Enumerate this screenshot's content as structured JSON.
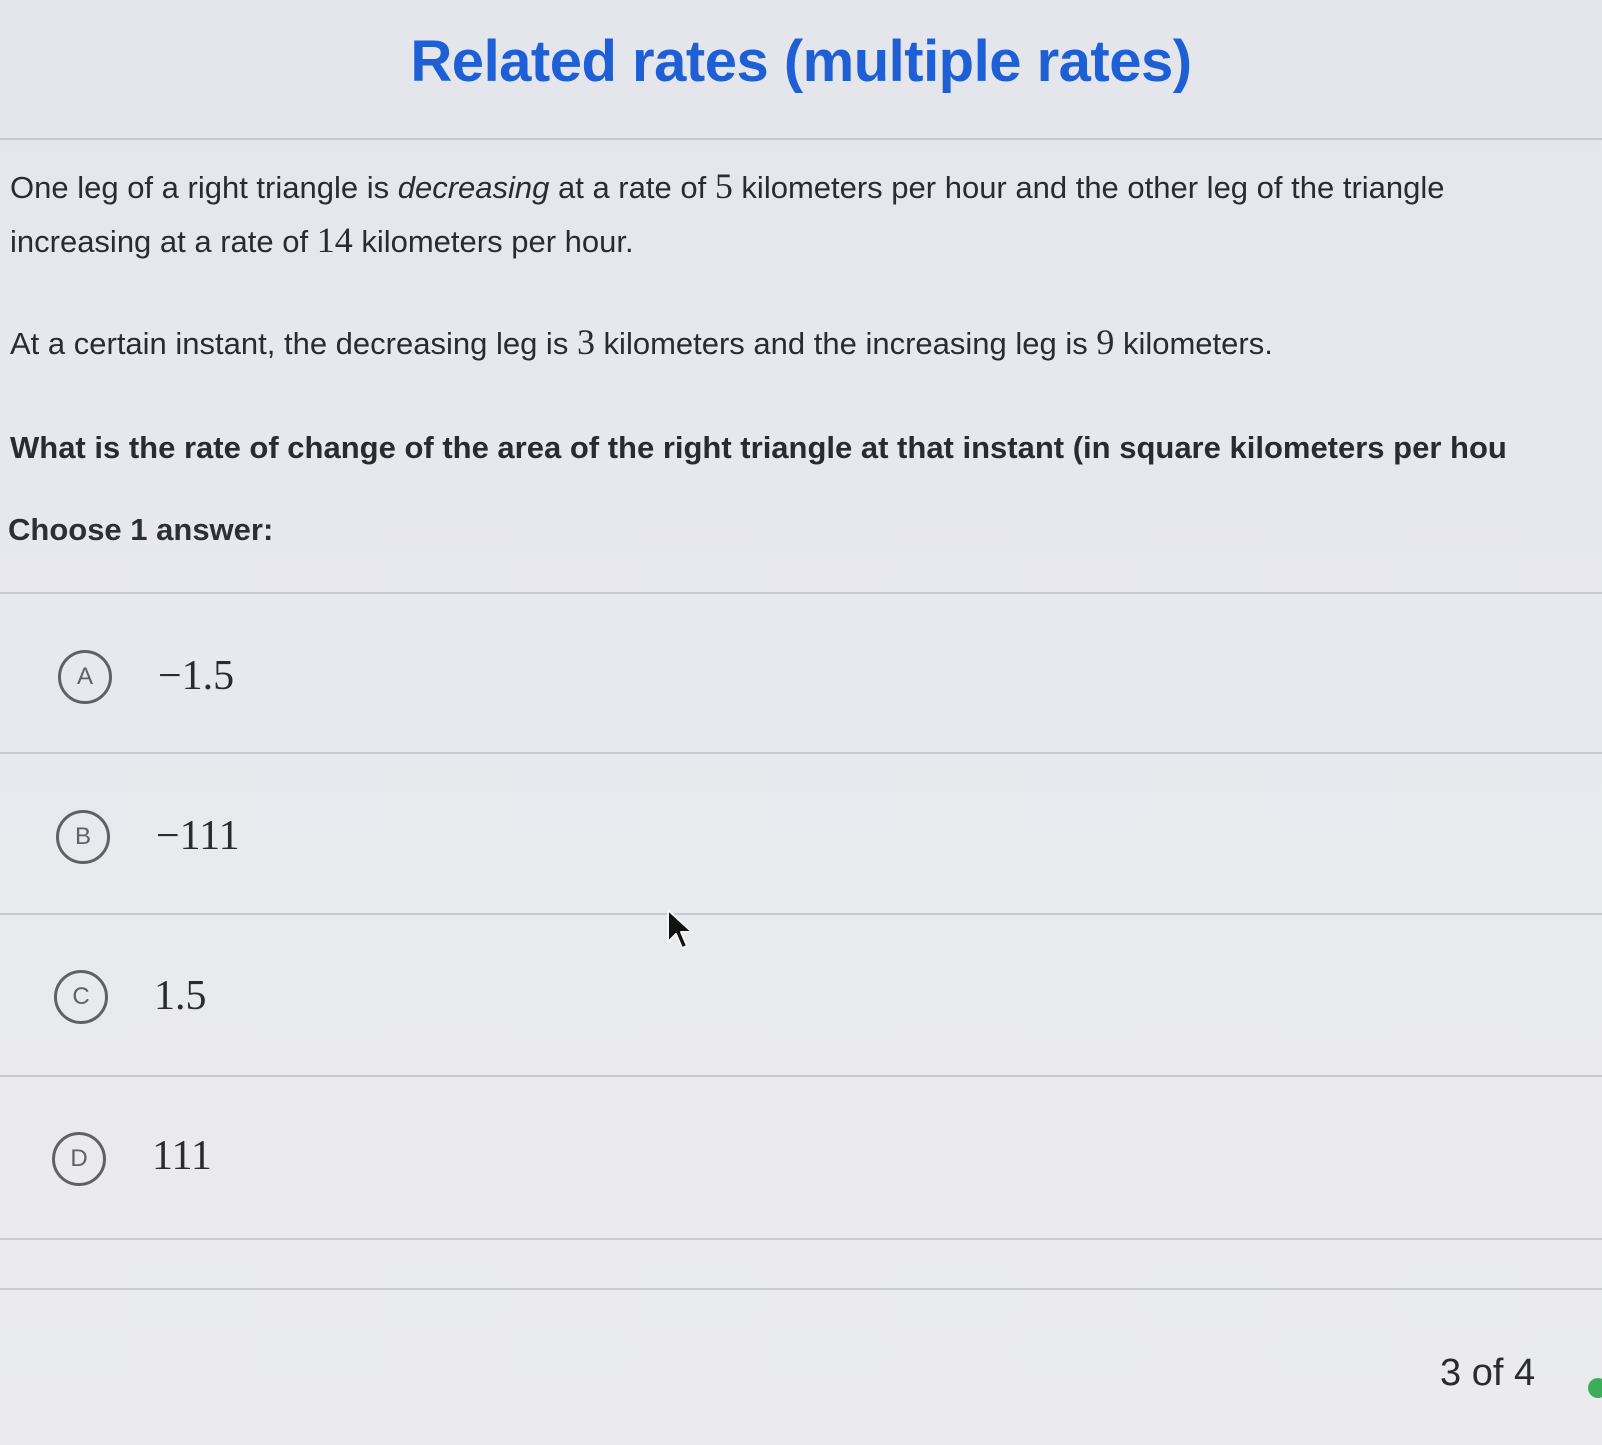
{
  "title": "Related rates (multiple rates)",
  "question": {
    "p1": {
      "a": "One leg of a right triangle is ",
      "em": "decreasing",
      "b": " at a rate of ",
      "n1": "5",
      "c": " kilometers per hour and the other leg of the triangle",
      "d": "increasing at a rate of ",
      "n2": "14",
      "e": " kilometers per hour."
    },
    "p2": {
      "a": "At a certain instant, the decreasing leg is ",
      "n1": "3",
      "b": " kilometers and the increasing leg is ",
      "n2": "9",
      "c": " kilometers."
    },
    "p3": "What is the rate of change of the area of the right triangle at that instant (in square kilometers per hou"
  },
  "choose_label": "Choose 1 answer:",
  "choices": [
    {
      "letter": "A",
      "value": "−1.5"
    },
    {
      "letter": "B",
      "value": "−111"
    },
    {
      "letter": "C",
      "value": "1.5"
    },
    {
      "letter": "D",
      "value": "111"
    }
  ],
  "pager": "3 of 4",
  "colors": {
    "title": "#1f5fd6",
    "text": "#2a2b2f",
    "circle": "#5f6168",
    "divider": "#c9cbd2",
    "progress_dot": "#3cae5a"
  },
  "icons": {
    "cursor": "mouse-pointer-icon"
  }
}
